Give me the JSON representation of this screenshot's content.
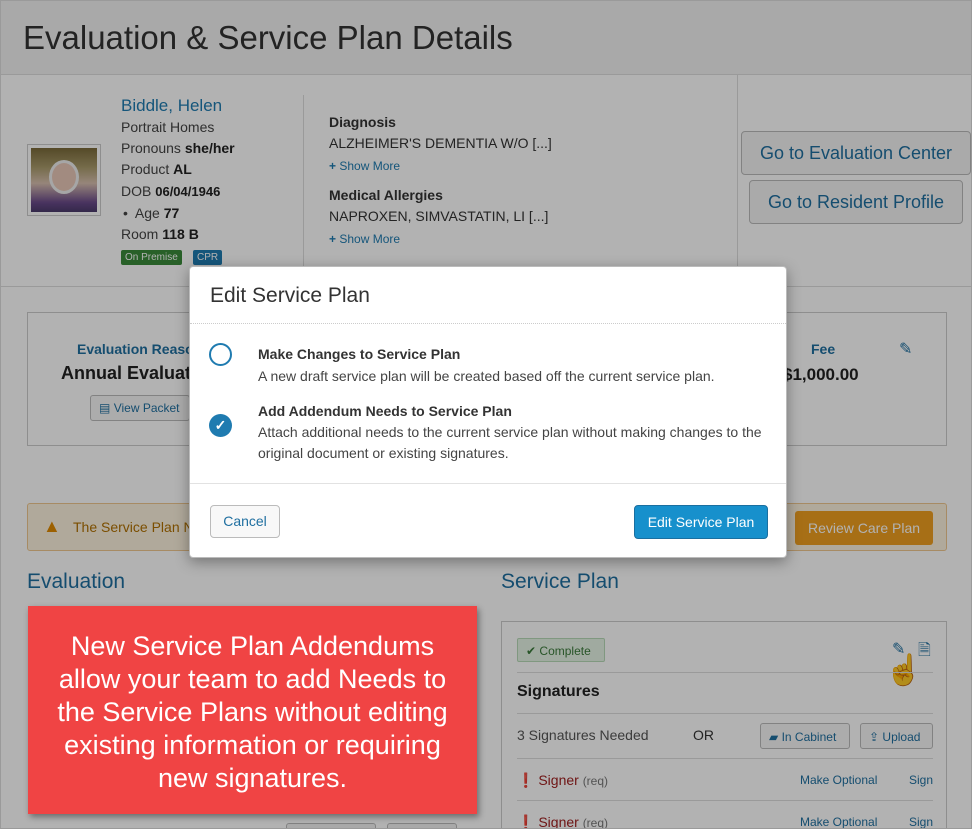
{
  "page": {
    "title": "Evaluation & Service Plan Details"
  },
  "resident": {
    "name": "Biddle, Helen",
    "community": "Portrait Homes",
    "pronouns_label": "Pronouns",
    "pronouns": "she/her",
    "product_label": "Product",
    "product": "AL",
    "dob_label": "DOB",
    "dob": "06/04/1946",
    "age_label": "Age",
    "age": "77",
    "room_label": "Room",
    "room": "118 B",
    "tags": [
      "On Premise",
      "CPR"
    ]
  },
  "diagnosis": {
    "label": "Diagnosis",
    "value": "ALZHEIMER'S DEMENTIA W/O [...]",
    "show_more": "Show More"
  },
  "allergies": {
    "label": "Medical Allergies",
    "value": "NAPROXEN, SIMVASTATIN, LI [...]",
    "show_more": "Show More"
  },
  "side_buttons": {
    "evaluation_center": "Go to Evaluation Center",
    "resident_profile": "Go to Resident Profile"
  },
  "evaluation_summary": {
    "reason_label": "Evaluation Reaso",
    "reason_value": "Annual Evaluati",
    "view_packet": "View Packet",
    "fee_label": "Fee",
    "fee_value": "$1,000.00"
  },
  "alert": {
    "text": "The Service Plan N",
    "review_button": "Review Care Plan"
  },
  "sections": {
    "evaluation": "Evaluation",
    "service_plan": "Service Plan"
  },
  "service_plan": {
    "status": "Complete",
    "signatures_title": "Signatures",
    "signatures_needed": "3 Signatures Needed",
    "or": "OR",
    "in_cabinet": "In Cabinet",
    "upload": "Upload",
    "signers": [
      {
        "label": "Signer",
        "req": "(req)",
        "make_optional": "Make Optional",
        "sign": "Sign"
      },
      {
        "label": "Signer",
        "req": "(req)",
        "make_optional": "Make Optional",
        "sign": "Sign"
      }
    ]
  },
  "modal": {
    "title": "Edit Service Plan",
    "options": [
      {
        "title": "Make Changes to Service Plan",
        "description": "A new draft service plan will be created based off the current service plan.",
        "selected": false
      },
      {
        "title": "Add Addendum Needs to Service Plan",
        "description": "Attach additional needs to the current service plan without making changes to the original document or existing signatures.",
        "selected": true
      }
    ],
    "cancel": "Cancel",
    "confirm": "Edit Service Plan"
  },
  "callout": {
    "text": "New Service Plan Addendums allow your team to add Needs to the Service Plans without editing existing information or requiring new signatures."
  },
  "colors": {
    "primary": "#1790cc",
    "link": "#1f6fa0",
    "callout": "#f04444",
    "warning": "#f0a020"
  }
}
